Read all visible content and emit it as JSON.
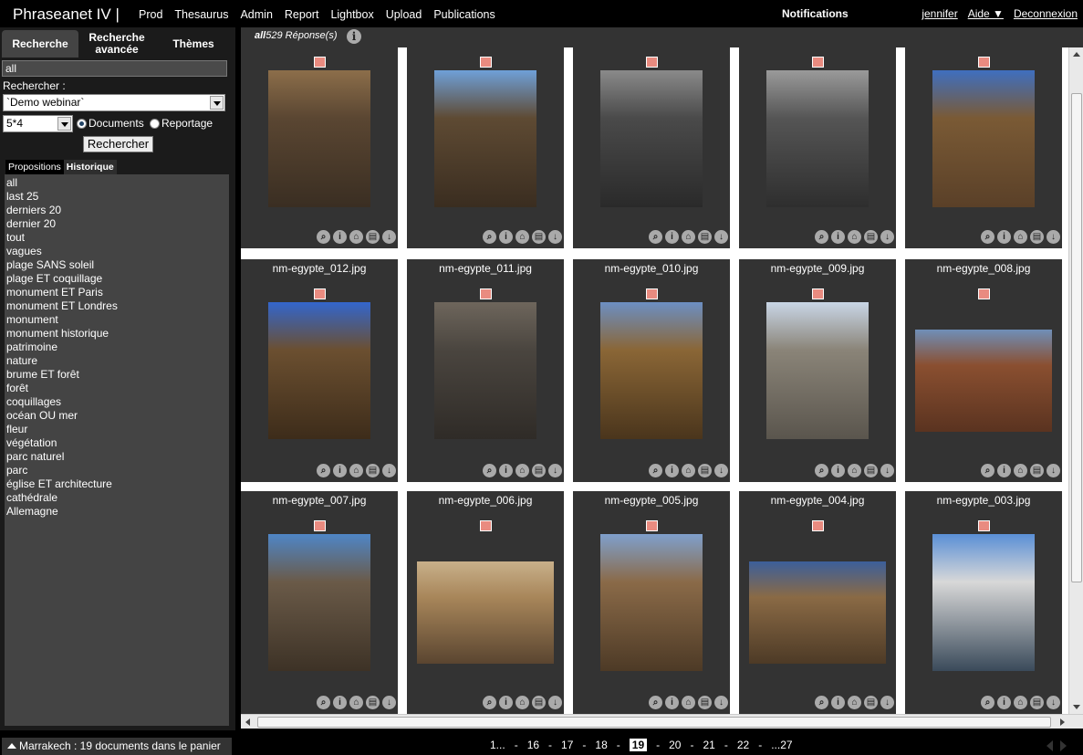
{
  "app": {
    "brand": "Phraseanet IV |",
    "nav": [
      "Prod",
      "Thesaurus",
      "Admin",
      "Report",
      "Lightbox",
      "Upload",
      "Publications"
    ],
    "notifications": "Notifications",
    "user": "jennifer",
    "help": "Aide ▼",
    "logout": "Deconnexion"
  },
  "search": {
    "tabs": [
      "Recherche",
      "Recherche avancée",
      "Thèmes"
    ],
    "query": "all",
    "search_in_label": "Rechercher :",
    "database": "`Demo webinar`",
    "per_page": "5*4",
    "mode_documents": "Documents",
    "mode_reportage": "Reportage",
    "submit": "Rechercher",
    "subtabs": [
      "Propositions",
      "Historique"
    ],
    "history": [
      "all",
      "last 25",
      "derniers 20",
      "dernier 20",
      "tout",
      "vagues",
      "plage SANS soleil",
      "plage ET coquillage",
      "monument ET Paris",
      "monument ET Londres",
      "monument",
      "monument historique",
      "patrimoine",
      "nature",
      "brume ET forêt",
      "forêt",
      "coquillages",
      "océan OU mer",
      "fleur",
      "végétation",
      "parc naturel",
      "parc",
      "église ET architecture",
      "cathédrale",
      "Allemagne"
    ]
  },
  "basket": "Marrakech : 19 documents dans le panier",
  "results": {
    "query": "all",
    "count": "529 Réponse(s)",
    "info_icon": "i",
    "items": [
      {
        "caption": "",
        "shape": "portrait",
        "palette": [
          "#5a4632",
          "#8c6e4a",
          "#3a2e22"
        ]
      },
      {
        "caption": "",
        "shape": "portrait",
        "palette": [
          "#5e4a33",
          "#6fa0d8",
          "#3a2d20"
        ]
      },
      {
        "caption": "",
        "shape": "portrait",
        "palette": [
          "#4a4a4a",
          "#8a8a8a",
          "#2a2a2a"
        ]
      },
      {
        "caption": "",
        "shape": "portrait",
        "palette": [
          "#555555",
          "#9a9a9a",
          "#2e2e2e"
        ]
      },
      {
        "caption": "",
        "shape": "portrait",
        "palette": [
          "#7a5a35",
          "#3f6fbf",
          "#5a4028"
        ]
      },
      {
        "caption": "nm-egypte_012.jpg",
        "shape": "portrait",
        "palette": [
          "#6b4f30",
          "#3366cc",
          "#3d2c1a"
        ]
      },
      {
        "caption": "nm-egypte_011.jpg",
        "shape": "portrait",
        "palette": [
          "#4a453f",
          "#6e665c",
          "#2f2b27"
        ]
      },
      {
        "caption": "nm-egypte_010.jpg",
        "shape": "portrait",
        "palette": [
          "#8a6636",
          "#6c8fc2",
          "#4a351c"
        ]
      },
      {
        "caption": "nm-egypte_009.jpg",
        "shape": "portrait",
        "palette": [
          "#8a8478",
          "#c9d6e6",
          "#5a554d"
        ]
      },
      {
        "caption": "nm-egypte_008.jpg",
        "shape": "landscape",
        "palette": [
          "#8a4f30",
          "#6f8fb8",
          "#5a3320"
        ]
      },
      {
        "caption": "nm-egypte_007.jpg",
        "shape": "portrait",
        "palette": [
          "#6a5a48",
          "#4f86c6",
          "#3d3226"
        ]
      },
      {
        "caption": "nm-egypte_006.jpg",
        "shape": "landscape",
        "palette": [
          "#a8865a",
          "#c8b08a",
          "#5a4530"
        ]
      },
      {
        "caption": "nm-egypte_005.jpg",
        "shape": "portrait",
        "palette": [
          "#8a6a48",
          "#7fa0cc",
          "#4d3a26"
        ]
      },
      {
        "caption": "nm-egypte_004.jpg",
        "shape": "landscape",
        "palette": [
          "#8a6a45",
          "#3c5f9a",
          "#4d3a26"
        ]
      },
      {
        "caption": "nm-egypte_003.jpg",
        "shape": "portrait",
        "palette": [
          "#d8d8d8",
          "#5a8fd6",
          "#3a4a5a"
        ]
      }
    ],
    "action_icons": [
      "zoom-icon",
      "info-icon",
      "basket-icon",
      "print-icon",
      "download-icon"
    ]
  },
  "pager": [
    "1...",
    "-",
    "16",
    "-",
    "17",
    "-",
    "18",
    "-",
    "19",
    "-",
    "20",
    "-",
    "21",
    "-",
    "22",
    "-",
    "...27"
  ],
  "pager_current": "19"
}
